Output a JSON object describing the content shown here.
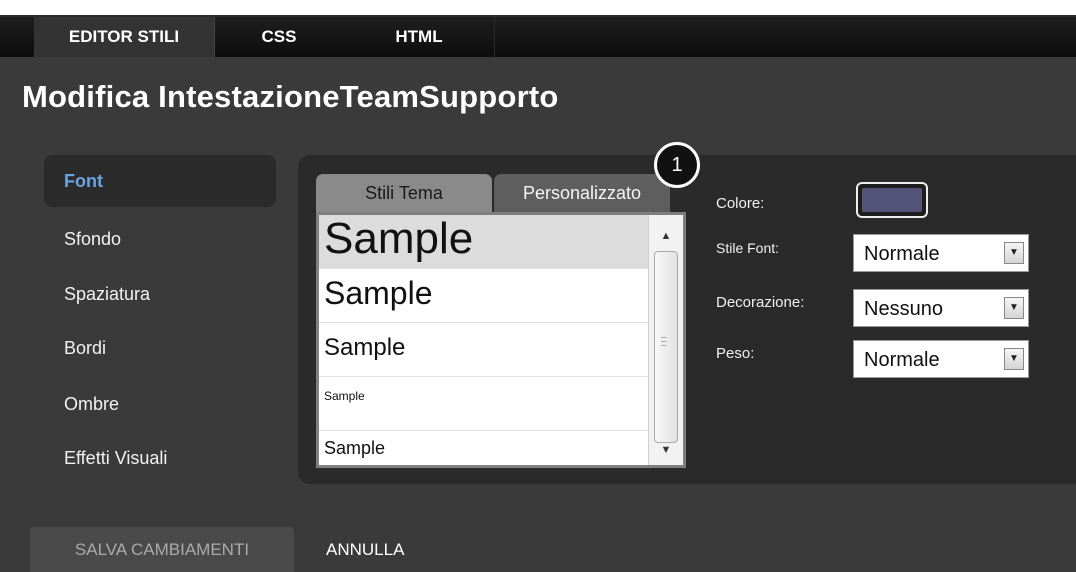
{
  "tabs": [
    {
      "label": "EDITOR STILI",
      "active": true
    },
    {
      "label": "CSS",
      "active": false
    },
    {
      "label": "HTML",
      "active": false
    }
  ],
  "page_title": "Modifica IntestazioneTeamSupporto",
  "sidebar": {
    "items": [
      {
        "label": "Font",
        "active": true
      },
      {
        "label": "Sfondo"
      },
      {
        "label": "Spaziatura"
      },
      {
        "label": "Bordi"
      },
      {
        "label": "Ombre"
      },
      {
        "label": "Effetti Visuali"
      }
    ]
  },
  "font_panel": {
    "sub_tabs": [
      {
        "label": "Stili Tema",
        "active": true
      },
      {
        "label": "Personalizzato",
        "active": false
      }
    ],
    "samples": [
      {
        "text": "Sample",
        "selected": true
      },
      {
        "text": "Sample"
      },
      {
        "text": "Sample"
      },
      {
        "text": "Sample"
      },
      {
        "text": "Sample"
      }
    ],
    "callout_number": "1"
  },
  "properties": {
    "color_label": "Colore:",
    "color_value": "#545478",
    "font_style_label": "Stile Font:",
    "font_style_value": "Normale",
    "decoration_label": "Decorazione:",
    "decoration_value": "Nessuno",
    "weight_label": "Peso:",
    "weight_value": "Normale"
  },
  "footer": {
    "save_label": "SALVA CAMBIAMENTI",
    "cancel_label": "ANNULLA"
  },
  "icons": [
    "scroll-up-icon",
    "scroll-down-icon",
    "dropdown-arrow-icon"
  ]
}
